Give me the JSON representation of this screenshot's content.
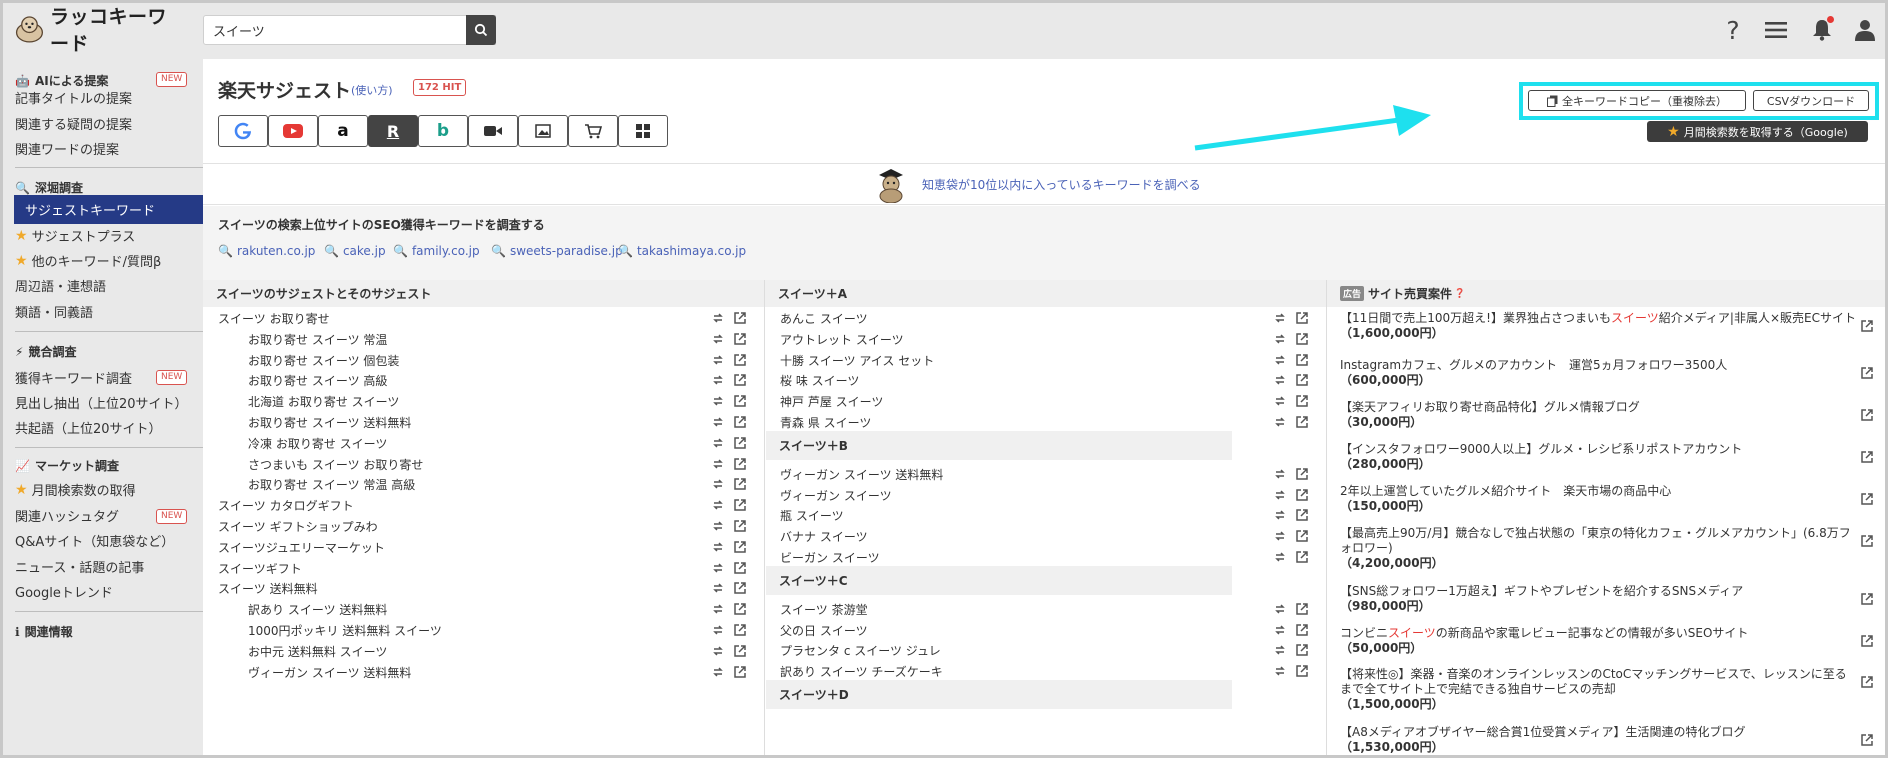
{
  "app": {
    "name": "ラッコキーワード"
  },
  "search": {
    "value": "スイーツ",
    "placeholder": ""
  },
  "sidebar": {
    "sections": [
      {
        "title": "AIによる提案",
        "badge": "NEW",
        "items": [
          "記事タイトルの提案",
          "関連する疑問の提案",
          "関連ワードの提案"
        ]
      },
      {
        "title": "深堀調査",
        "items": [
          "サジェストキーワード",
          "サジェストプラス",
          "他のキーワード/質問β",
          "周辺語・連想語",
          "類語・同義語"
        ]
      },
      {
        "title": "競合調査",
        "items": [
          "獲得キーワード調査",
          "見出し抽出（上位20サイト）",
          "共起語（上位20サイト）"
        ],
        "badge_item": "NEW"
      },
      {
        "title": "マーケット調査",
        "items": [
          "月間検索数の取得",
          "関連ハッシュタグ",
          "Q&Aサイト（知恵袋など）",
          "ニュース・話題の記事",
          "Googleトレンド"
        ],
        "badge_item": "NEW"
      },
      {
        "title": "関連情報"
      }
    ]
  },
  "toolbar": {
    "title": "楽天サジェスト",
    "howto": "(使い方)",
    "hit_count": "172",
    "hit_label": "HIT",
    "engines": [
      "google",
      "youtube",
      "amazon",
      "rakuten",
      "bing",
      "video",
      "image",
      "shopping",
      "apps"
    ],
    "copy_label": "全キーワードコピー（重複除去）",
    "csv_label": "CSVダウンロード",
    "monthly_label": "月間検索数を取得する（Google)"
  },
  "chiebukuro": {
    "label": "知恵袋が10位以内に入っているキーワードを調べる"
  },
  "seo": {
    "title": "スイーツの検索上位サイトのSEO獲得キーワードを調査する",
    "links": [
      "rakuten.co.jp",
      "cake.jp",
      "family.co.jp",
      "sweets-paradise.jp",
      "takashimaya.co.jp"
    ]
  },
  "col1": {
    "title": "スイーツのサジェストとそのサジェスト",
    "rows": [
      {
        "text": "スイーツ お取り寄せ",
        "indent": false
      },
      {
        "text": "お取り寄せ スイーツ 常温",
        "indent": true
      },
      {
        "text": "お取り寄せ スイーツ 個包装",
        "indent": true
      },
      {
        "text": "お取り寄せ スイーツ 高級",
        "indent": true
      },
      {
        "text": "北海道 お取り寄せ スイーツ",
        "indent": true
      },
      {
        "text": "お取り寄せ スイーツ 送料無料",
        "indent": true
      },
      {
        "text": "冷凍 お取り寄せ スイーツ",
        "indent": true
      },
      {
        "text": "さつまいも スイーツ お取り寄せ",
        "indent": true
      },
      {
        "text": "お取り寄せ スイーツ 常温 高級",
        "indent": true
      },
      {
        "text": "スイーツ カタログギフト",
        "indent": false
      },
      {
        "text": "スイーツ ギフトショップみわ",
        "indent": false
      },
      {
        "text": "スイーツジュエリーマーケット",
        "indent": false
      },
      {
        "text": "スイーツギフト",
        "indent": false
      },
      {
        "text": "スイーツ 送料無料",
        "indent": false
      },
      {
        "text": "訳あり スイーツ 送料無料",
        "indent": true
      },
      {
        "text": "1000円ポッキリ 送料無料 スイーツ",
        "indent": true
      },
      {
        "text": "お中元 送料無料 スイーツ",
        "indent": true
      },
      {
        "text": "ヴィーガン スイーツ 送料無料",
        "indent": true
      }
    ]
  },
  "col2": {
    "title": "スイーツ＋A",
    "groups": [
      {
        "title": "スイーツ＋A",
        "rows": [
          "あんこ スイーツ",
          "アウトレット スイーツ",
          "十勝 スイーツ アイス セット",
          "桜 味 スイーツ",
          "神戸 芦屋 スイーツ",
          "青森 県 スイーツ"
        ]
      },
      {
        "title": "スイーツ＋B",
        "rows": [
          "ヴィーガン スイーツ 送料無料",
          "ヴィーガン スイーツ",
          "瓶 スイーツ",
          "バナナ スイーツ",
          "ビーガン スイーツ"
        ]
      },
      {
        "title": "スイーツ＋C",
        "rows": [
          "スイーツ 茶游堂",
          "父の日 スイーツ",
          "プラセンタ c スイーツ ジュレ",
          "訳あり スイーツ チーズケーキ"
        ]
      },
      {
        "title": "スイーツ＋D",
        "rows": []
      }
    ]
  },
  "col3": {
    "ad_label": "広告",
    "title": "サイト売買案件",
    "deals": [
      {
        "pre": "【11日間で売上100万超え!】業界独占さつまいも",
        "hl": "スイーツ",
        "post": "紹介メディア|非属人×販売ECサイト",
        "price": "（1,600,000円）"
      },
      {
        "pre": "Instagramカフェ、グルメのアカウント　運営5ヵ月フォロワー3500人",
        "hl": "",
        "post": "",
        "price": "（600,000円）"
      },
      {
        "pre": "【楽天アフィリお取り寄せ商品特化】グルメ情報ブログ",
        "hl": "",
        "post": "",
        "price": "（30,000円）"
      },
      {
        "pre": "【インスタフォロワー9000人以上】グルメ・レシピ系リポストアカウント",
        "hl": "",
        "post": "",
        "price": "（280,000円）"
      },
      {
        "pre": "2年以上運営していたグルメ紹介サイト　楽天市場の商品中心",
        "hl": "",
        "post": "",
        "price": "（150,000円）"
      },
      {
        "pre": "【最高売上90万/月】競合なしで独占状態の「東京の特化カフェ・グルメアカウント」(6.8万フォロワー)",
        "hl": "",
        "post": "",
        "price": "（4,200,000円）"
      },
      {
        "pre": "【SNS総フォロワー1万超え】ギフトやプレゼントを紹介するSNSメディア",
        "hl": "",
        "post": "",
        "price": "（980,000円）"
      },
      {
        "pre": "コンビニ",
        "hl": "スイーツ",
        "post": "の新商品や家電レビュー記事などの情報が多いSEOサイト",
        "price": "（50,000円）"
      },
      {
        "pre": "【将来性◎】楽器・音楽のオンラインレッスンのCtoCマッチングサービスで、レッスンに至るまで全てサイト上で完結できる独自サービスの売却",
        "hl": "",
        "post": "",
        "price": "（1,500,000円）"
      },
      {
        "pre": "【A8メディアオブザイヤー総合賞1位受賞メディア】生活関連の特化ブログ",
        "hl": "",
        "post": "",
        "price": "（1,530,000円）"
      }
    ]
  },
  "colors": {
    "accent": "#253a86",
    "link": "#4a62b7",
    "highlight": "#1ee0ee",
    "badge": "#d9534f"
  }
}
